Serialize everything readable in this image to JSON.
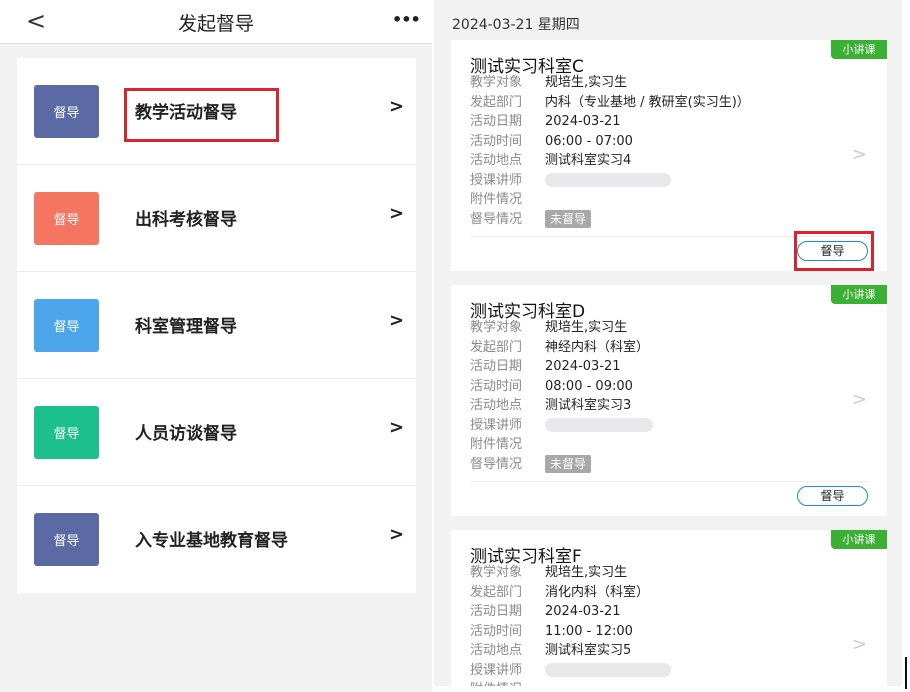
{
  "left": {
    "nav": {
      "back": "<",
      "title": "发起督导",
      "more": "•••"
    },
    "menu": [
      {
        "badge": "督导",
        "badge_color": "#5b6aa5",
        "label": "教学活动督导",
        "chevron": ">"
      },
      {
        "badge": "督导",
        "badge_color": "#f47560",
        "label": "出科考核督导",
        "chevron": ">"
      },
      {
        "badge": "督导",
        "badge_color": "#4da6ec",
        "label": "科室管理督导",
        "chevron": ">"
      },
      {
        "badge": "督导",
        "badge_color": "#1dbf8d",
        "label": "人员访谈督导",
        "chevron": ">"
      },
      {
        "badge": "督导",
        "badge_color": "#5b6aa5",
        "label": "入专业基地教育督导",
        "chevron": ">"
      }
    ]
  },
  "right": {
    "date_header": "2024-03-21 星期四",
    "cards": [
      {
        "tag": "小讲课",
        "title": "测试实习科室C",
        "rows": [
          {
            "key": "教学对象",
            "value": "规培生,实习生"
          },
          {
            "key": "发起部门",
            "value": "内科（专业基地 / 教研室(实习生)）"
          },
          {
            "key": "活动日期",
            "value": "2024-03-21"
          },
          {
            "key": "活动时间",
            "value": "06:00 - 07:00"
          },
          {
            "key": "活动地点",
            "value": "测试科室实习4"
          },
          {
            "key": "授课讲师",
            "value": ""
          },
          {
            "key": "附件情况",
            "value": ""
          },
          {
            "key": "督导情况",
            "value": "未督导"
          }
        ],
        "action": "督导",
        "arrow": ">"
      },
      {
        "tag": "小讲课",
        "title": "测试实习科室D",
        "rows": [
          {
            "key": "教学对象",
            "value": "规培生,实习生"
          },
          {
            "key": "发起部门",
            "value": "神经内科（科室）"
          },
          {
            "key": "活动日期",
            "value": "2024-03-21"
          },
          {
            "key": "活动时间",
            "value": "08:00 - 09:00"
          },
          {
            "key": "活动地点",
            "value": "测试科室实习3"
          },
          {
            "key": "授课讲师",
            "value": ""
          },
          {
            "key": "附件情况",
            "value": ""
          },
          {
            "key": "督导情况",
            "value": "未督导"
          }
        ],
        "action": "督导",
        "arrow": ">"
      },
      {
        "tag": "小讲课",
        "title": "测试实习科室F",
        "rows": [
          {
            "key": "教学对象",
            "value": "规培生,实习生"
          },
          {
            "key": "发起部门",
            "value": "消化内科（科室）"
          },
          {
            "key": "活动日期",
            "value": "2024-03-21"
          },
          {
            "key": "活动时间",
            "value": "11:00 - 12:00"
          },
          {
            "key": "活动地点",
            "value": "测试科室实习5"
          },
          {
            "key": "授课讲师",
            "value": ""
          },
          {
            "key": "附件情况",
            "value": ""
          }
        ],
        "arrow": ">"
      }
    ]
  }
}
